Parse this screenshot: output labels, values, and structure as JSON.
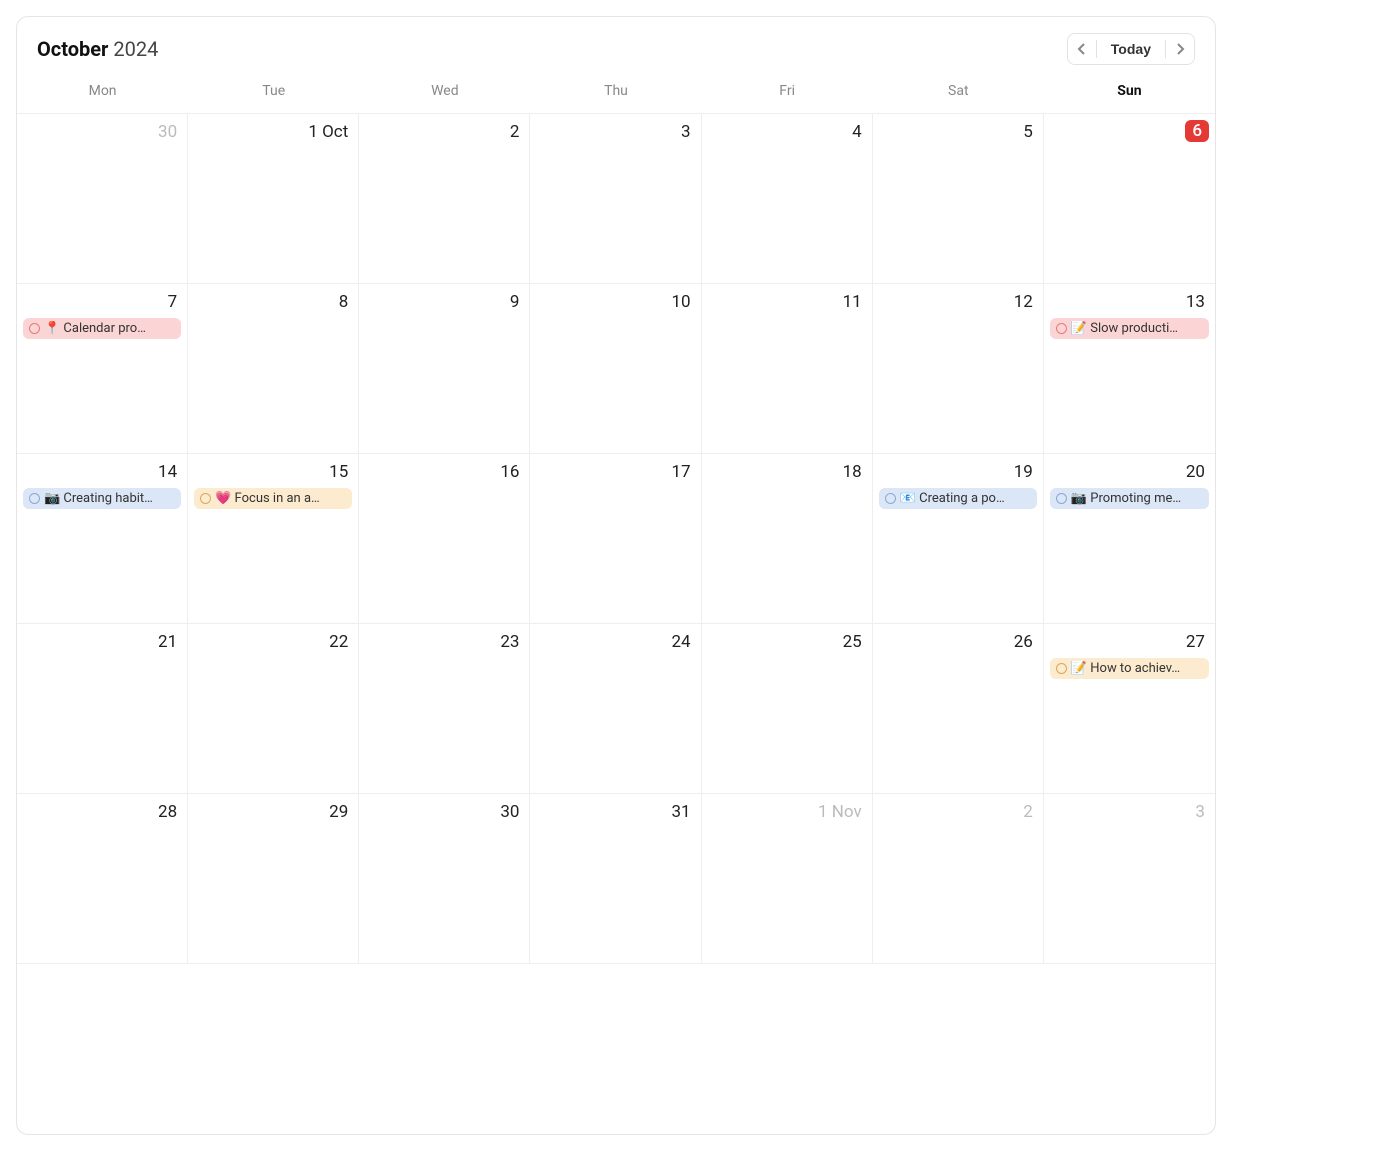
{
  "header": {
    "month": "October",
    "year": "2024",
    "today_label": "Today"
  },
  "weekdays": [
    "Mon",
    "Tue",
    "Wed",
    "Thu",
    "Fri",
    "Sat",
    "Sun"
  ],
  "weekday_bold_index": 6,
  "colors": {
    "red": "#fbd5d5",
    "blue": "#dbe6f7",
    "orange": "#fcebcf",
    "today_chip": "#e53935"
  },
  "cells": [
    {
      "label": "30",
      "other": true,
      "today": false,
      "events": []
    },
    {
      "label": "1 Oct",
      "other": false,
      "today": false,
      "events": []
    },
    {
      "label": "2",
      "other": false,
      "today": false,
      "events": []
    },
    {
      "label": "3",
      "other": false,
      "today": false,
      "events": []
    },
    {
      "label": "4",
      "other": false,
      "today": false,
      "events": []
    },
    {
      "label": "5",
      "other": false,
      "today": false,
      "events": []
    },
    {
      "label": "6",
      "other": false,
      "today": true,
      "events": []
    },
    {
      "label": "7",
      "other": false,
      "today": false,
      "events": [
        {
          "color": "red",
          "emoji": "📍",
          "text": "Calendar pro…"
        }
      ]
    },
    {
      "label": "8",
      "other": false,
      "today": false,
      "events": []
    },
    {
      "label": "9",
      "other": false,
      "today": false,
      "events": []
    },
    {
      "label": "10",
      "other": false,
      "today": false,
      "events": []
    },
    {
      "label": "11",
      "other": false,
      "today": false,
      "events": []
    },
    {
      "label": "12",
      "other": false,
      "today": false,
      "events": []
    },
    {
      "label": "13",
      "other": false,
      "today": false,
      "events": [
        {
          "color": "red",
          "emoji": "📝",
          "text": "Slow producti…"
        }
      ]
    },
    {
      "label": "14",
      "other": false,
      "today": false,
      "events": [
        {
          "color": "blue",
          "emoji": "📷",
          "text": "Creating habit…"
        }
      ]
    },
    {
      "label": "15",
      "other": false,
      "today": false,
      "events": [
        {
          "color": "orange",
          "emoji": "💗",
          "text": "Focus in an a…"
        }
      ]
    },
    {
      "label": "16",
      "other": false,
      "today": false,
      "events": []
    },
    {
      "label": "17",
      "other": false,
      "today": false,
      "events": []
    },
    {
      "label": "18",
      "other": false,
      "today": false,
      "events": []
    },
    {
      "label": "19",
      "other": false,
      "today": false,
      "events": [
        {
          "color": "blue",
          "emoji": "📧",
          "text": "Creating a po…"
        }
      ]
    },
    {
      "label": "20",
      "other": false,
      "today": false,
      "events": [
        {
          "color": "blue",
          "emoji": "📷",
          "text": "Promoting me…"
        }
      ]
    },
    {
      "label": "21",
      "other": false,
      "today": false,
      "events": []
    },
    {
      "label": "22",
      "other": false,
      "today": false,
      "events": []
    },
    {
      "label": "23",
      "other": false,
      "today": false,
      "events": []
    },
    {
      "label": "24",
      "other": false,
      "today": false,
      "events": []
    },
    {
      "label": "25",
      "other": false,
      "today": false,
      "events": []
    },
    {
      "label": "26",
      "other": false,
      "today": false,
      "events": []
    },
    {
      "label": "27",
      "other": false,
      "today": false,
      "events": [
        {
          "color": "orange",
          "emoji": "📝",
          "text": "How to achiev…"
        }
      ]
    },
    {
      "label": "28",
      "other": false,
      "today": false,
      "events": []
    },
    {
      "label": "29",
      "other": false,
      "today": false,
      "events": []
    },
    {
      "label": "30",
      "other": false,
      "today": false,
      "events": []
    },
    {
      "label": "31",
      "other": false,
      "today": false,
      "events": []
    },
    {
      "label": "1 Nov",
      "other": true,
      "today": false,
      "events": []
    },
    {
      "label": "2",
      "other": true,
      "today": false,
      "events": []
    },
    {
      "label": "3",
      "other": true,
      "today": false,
      "events": []
    }
  ]
}
